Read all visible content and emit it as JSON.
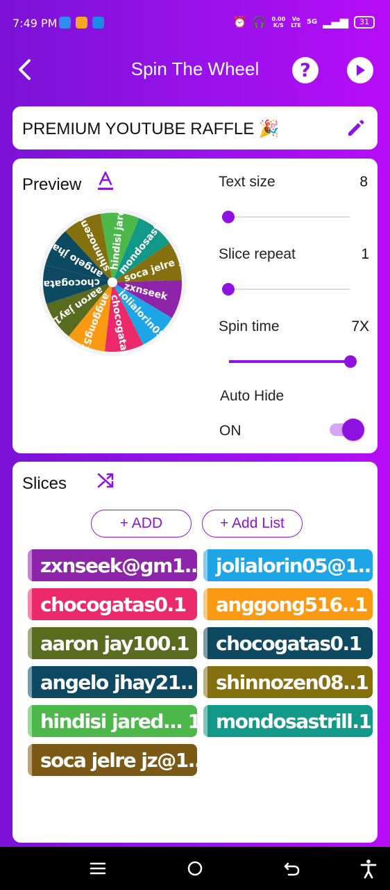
{
  "status": {
    "time": "7:49 PM",
    "net_speed_value": "0.00",
    "net_speed_unit": "K/S",
    "volte_top": "Vo",
    "volte_bottom": "LTE",
    "network": "5G",
    "battery": "31"
  },
  "header": {
    "title": "Spin The Wheel"
  },
  "raffle": {
    "title": "PREMIUM YOUTUBE RAFFLE 🎉"
  },
  "preview": {
    "label": "Preview",
    "wheel_labels": [
      "hindisi jared",
      "mondosastrill",
      "soca jelre jz",
      "zxnseek",
      "jolialorin05",
      "chocogatas01",
      "anggong516",
      "aaron jay100",
      "chocogatas01",
      "angelo jhay21",
      "shinnozen08"
    ]
  },
  "settings": {
    "text_size": {
      "label": "Text size",
      "value": "8",
      "slider_fraction": 0.0
    },
    "slice_repeat": {
      "label": "Slice repeat",
      "value": "1",
      "slider_fraction": 0.0
    },
    "spin_time": {
      "label": "Spin time",
      "value": "7X",
      "slider_fraction": 1.0
    },
    "auto_hide": {
      "label": "Auto Hide",
      "state": "ON"
    }
  },
  "slices": {
    "label": "Slices",
    "add_label": "+ ADD",
    "add_list_label": "+ Add List",
    "items": [
      {
        "text": "zxnseek@gm1..",
        "color": "#8e24aa"
      },
      {
        "text": "jolialorin05@1..",
        "color": "#1ea5e8"
      },
      {
        "text": "chocogatas0.1",
        "color": "#ec2a6b"
      },
      {
        "text": "anggong516..1",
        "color": "#fb9a12"
      },
      {
        "text": "aaron jay100.1",
        "color": "#596b1f"
      },
      {
        "text": "chocogatas0.1",
        "color": "#0d4a62"
      },
      {
        "text": "angelo jhay21..",
        "color": "#0d4a62"
      },
      {
        "text": "shinnozen08..1",
        "color": "#857010"
      },
      {
        "text": "hindisi jared... 1",
        "color": "#4cb84a"
      },
      {
        "text": "mondosastrill.1",
        "color": "#129888"
      },
      {
        "text": "soca jelre jz@1..",
        "color": "#7a5a14"
      }
    ]
  },
  "wheel_colors": [
    "#4cb84a",
    "#129888",
    "#857010",
    "#8e24aa",
    "#1ea5e8",
    "#ec2a6b",
    "#fb9a12",
    "#596b1f",
    "#0d4a62",
    "#0d4a62",
    "#857010"
  ],
  "accent": "#8e12e0"
}
